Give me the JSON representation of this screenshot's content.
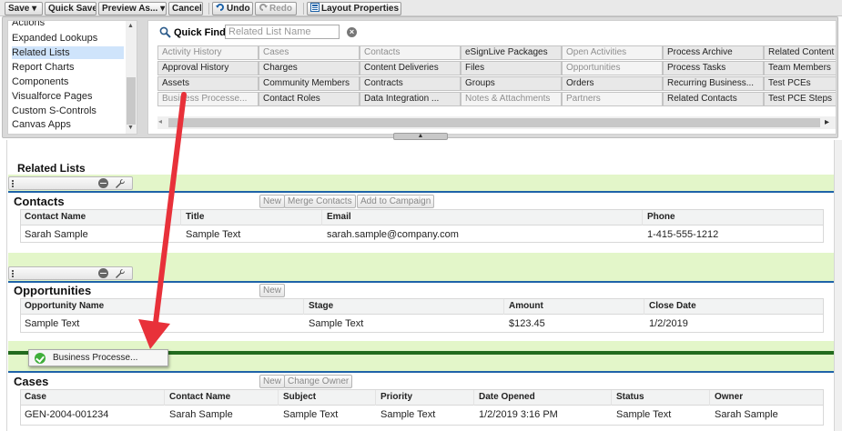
{
  "toolbar": {
    "save": "Save ▾",
    "quick_save": "Quick Save",
    "preview_as": "Preview As... ▾",
    "cancel": "Cancel",
    "undo": "Undo",
    "redo": "Redo",
    "layout_properties": "Layout Properties"
  },
  "palette": {
    "categories": [
      {
        "label": "Actions"
      },
      {
        "label": "Expanded Lookups"
      },
      {
        "label": "Related Lists",
        "selected": true
      },
      {
        "label": "Report Charts"
      },
      {
        "label": "Components"
      },
      {
        "label": "Visualforce Pages"
      },
      {
        "label": "Custom S-Controls"
      },
      {
        "label": "Canvas Apps"
      }
    ],
    "quick_find_label": "Quick Find",
    "quick_find_placeholder": "Related List Name",
    "clear_symbol": "×",
    "tiles": [
      [
        "Activity History",
        "Cases",
        "Contacts",
        "eSignLive Packages",
        "Open Activities",
        "Process Archive",
        "Related Content"
      ],
      [
        "Approval History",
        "Charges",
        "Content Deliveries",
        "Files",
        "Opportunities",
        "Process Tasks",
        "Team Members"
      ],
      [
        "Assets",
        "Community Members",
        "Contracts",
        "Groups",
        "Orders",
        "Recurring Business...",
        "Test PCEs"
      ],
      [
        "Business Processe...",
        "Contact Roles",
        "Data Integration ...",
        "Notes & Attachments",
        "Partners",
        "Related Contacts",
        "Test PCE Steps"
      ]
    ],
    "tile_state": [
      [
        "used",
        "used",
        "used",
        "avail",
        "used",
        "avail",
        "avail"
      ],
      [
        "avail",
        "avail",
        "avail",
        "avail",
        "used",
        "avail",
        "avail"
      ],
      [
        "avail",
        "avail",
        "avail",
        "avail",
        "avail",
        "avail",
        "avail"
      ],
      [
        "used",
        "avail",
        "avail",
        "used",
        "used",
        "avail",
        "avail"
      ]
    ]
  },
  "layout": {
    "section_title": "Related Lists",
    "contacts": {
      "title": "Contacts",
      "buttons": [
        "New",
        "Merge Contacts",
        "Add to Campaign"
      ],
      "columns": [
        "Contact Name",
        "Title",
        "Email",
        "Phone"
      ],
      "row": [
        "Sarah Sample",
        "Sample Text",
        "sarah.sample@company.com",
        "1-415-555-1212"
      ]
    },
    "opportunities": {
      "title": "Opportunities",
      "buttons": [
        "New"
      ],
      "columns": [
        "Opportunity Name",
        "Stage",
        "Amount",
        "Close Date"
      ],
      "row": [
        "Sample Text",
        "Sample Text",
        "$123.45",
        "1/2/2019"
      ]
    },
    "drag_chip": "Business Processe...",
    "cases": {
      "title": "Cases",
      "buttons": [
        "New",
        "Change Owner"
      ],
      "columns": [
        "Case",
        "Contact Name",
        "Subject",
        "Priority",
        "Date Opened",
        "Status",
        "Owner"
      ],
      "row": [
        "GEN-2004-001234",
        "Sarah Sample",
        "Sample Text",
        "Sample Text",
        "1/2/2019 3:16 PM",
        "Sample Text",
        "Sarah Sample"
      ]
    }
  },
  "colors": {
    "accent_blue": "#1f63a8",
    "drop_green": "#226b1e",
    "section_green": "#e3f6c9",
    "arrow_red": "#e8313a"
  }
}
